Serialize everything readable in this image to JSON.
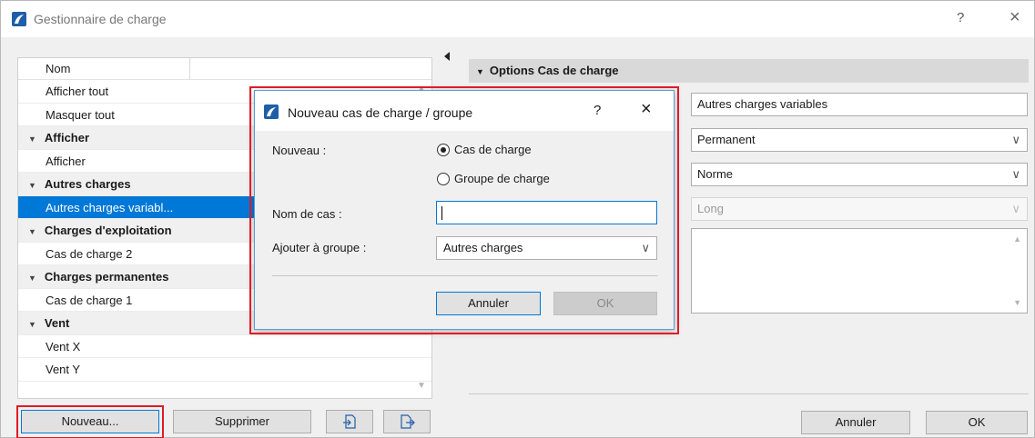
{
  "window": {
    "title": "Gestionnaire de charge",
    "help": "?",
    "close": "×"
  },
  "list": {
    "column_header": "Nom",
    "rows": [
      {
        "label": "Afficher tout",
        "type": "item"
      },
      {
        "label": "Masquer tout",
        "type": "item"
      },
      {
        "label": "Afficher",
        "type": "group"
      },
      {
        "label": "Afficher",
        "type": "item"
      },
      {
        "label": "Autres charges",
        "type": "group"
      },
      {
        "label": "Autres charges variabl...",
        "type": "item",
        "selected": true
      },
      {
        "label": "Charges d'exploitation",
        "type": "group"
      },
      {
        "label": "Cas de charge 2",
        "type": "item"
      },
      {
        "label": "Charges permanentes",
        "type": "group"
      },
      {
        "label": "Cas de charge 1",
        "type": "item"
      },
      {
        "label": "Vent",
        "type": "group"
      },
      {
        "label": "Vent X",
        "type": "item"
      },
      {
        "label": "Vent Y",
        "type": "item"
      }
    ]
  },
  "left_buttons": {
    "new": "Nouveau...",
    "delete": "Supprimer"
  },
  "options": {
    "header": "Options Cas de charge",
    "name_value": "Autres charges variables",
    "type_value": "Permanent",
    "norm_value": "Norme",
    "duration_value": "Long"
  },
  "bottom_buttons": {
    "cancel": "Annuler",
    "ok": "OK"
  },
  "dialog": {
    "title": "Nouveau cas de charge / groupe",
    "help": "?",
    "close": "×",
    "new_label": "Nouveau :",
    "radio_case": "Cas de charge",
    "radio_group": "Groupe de charge",
    "case_name_label": "Nom de cas :",
    "case_name_value": "",
    "add_to_group_label": "Ajouter à groupe :",
    "add_to_group_value": "Autres charges",
    "cancel": "Annuler",
    "ok": "OK"
  },
  "colors": {
    "selection": "#0078d7",
    "highlight": "#e01b24",
    "app_icon": "#1f5fa8"
  }
}
